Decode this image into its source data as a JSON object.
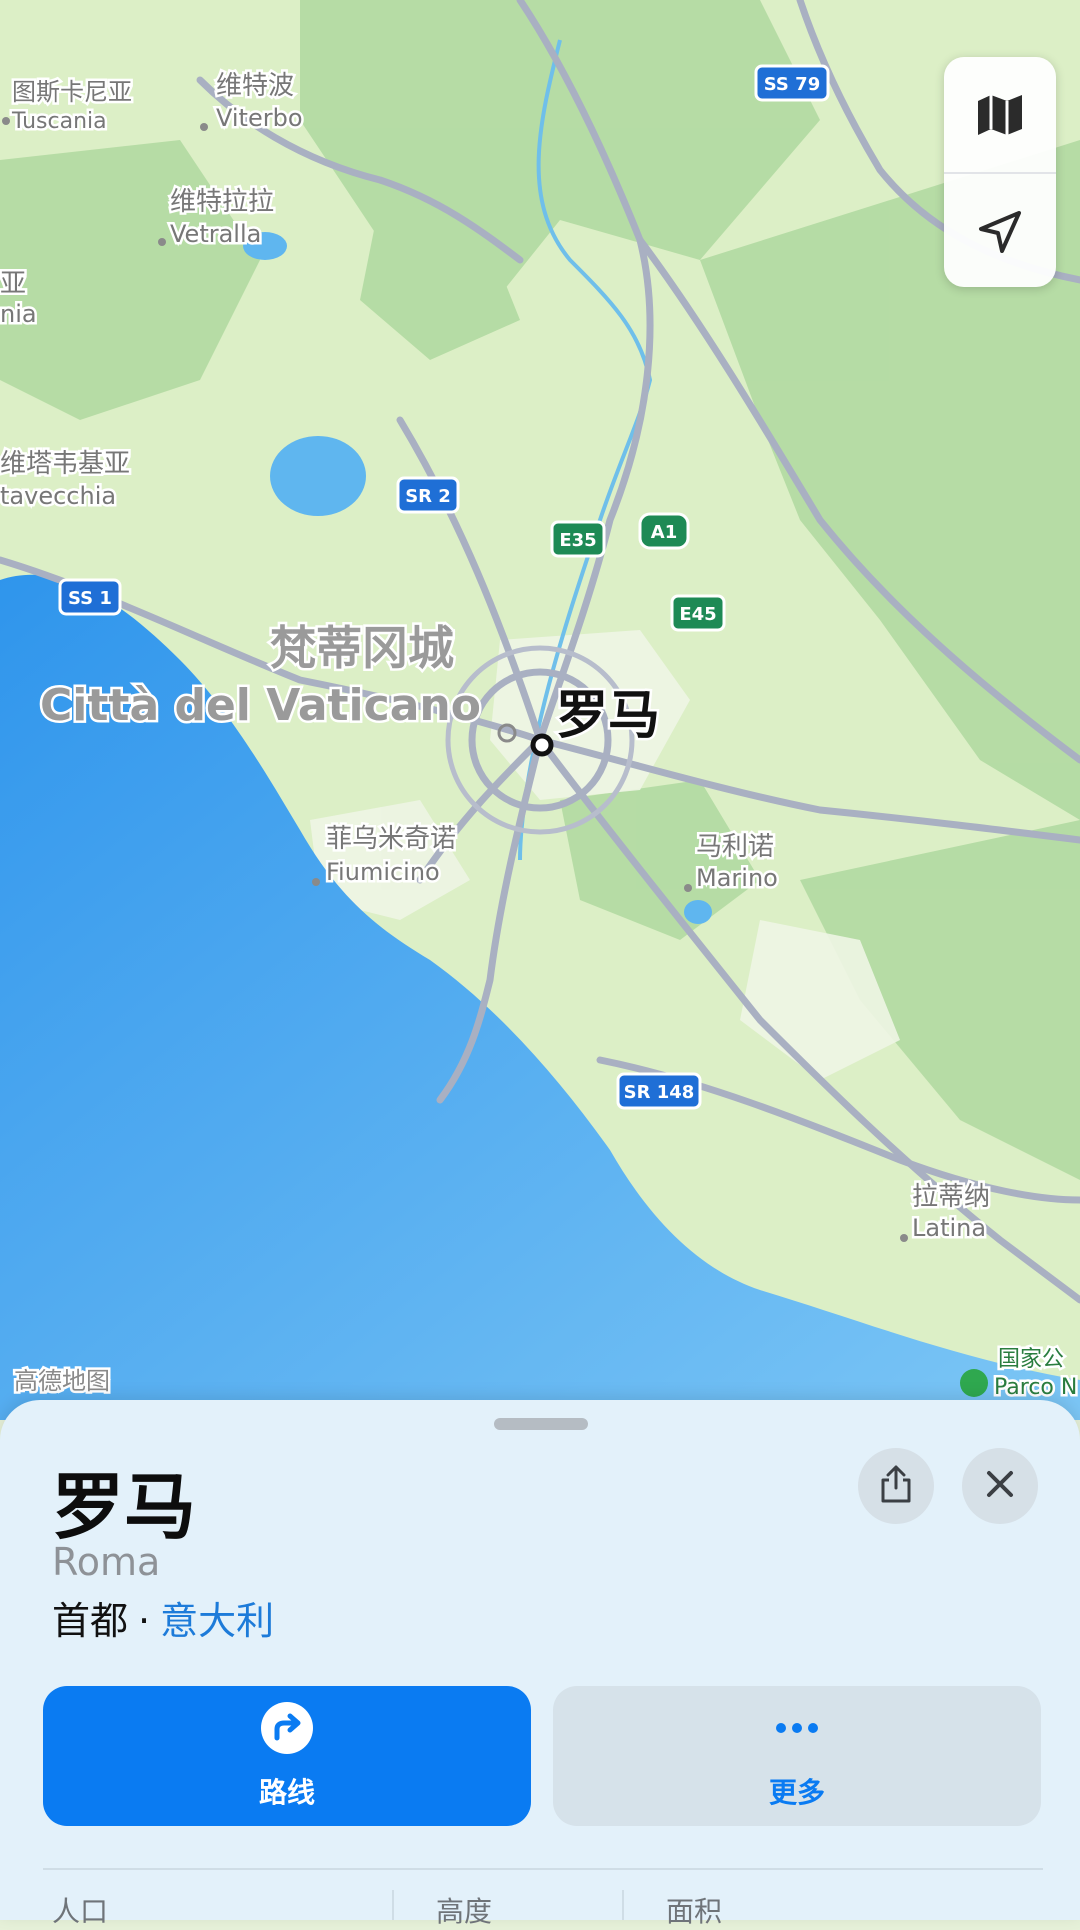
{
  "map": {
    "attribution": "高德地图",
    "places": [
      {
        "cn": "图斯卡尼亚",
        "latin": "Tuscania"
      },
      {
        "cn": "维特波",
        "latin": "Viterbo"
      },
      {
        "cn": "维特拉拉",
        "latin": "Vetralla"
      },
      {
        "cn": "亚",
        "latin": "nia"
      },
      {
        "cn": "维塔韦基亚",
        "latin": "tavecchia"
      },
      {
        "cn": "梵蒂冈城",
        "latin": "Città del Vaticano"
      },
      {
        "cn": "罗马",
        "latin": ""
      },
      {
        "cn": "菲乌米奇诺",
        "latin": "Fiumicino"
      },
      {
        "cn": "马利诺",
        "latin": "Marino"
      },
      {
        "cn": "拉蒂纳",
        "latin": "Latina"
      },
      {
        "cn": "国家公",
        "latin": "Parco N"
      }
    ],
    "road_shields": [
      {
        "label": "SS 79",
        "kind": "blue"
      },
      {
        "label": "SR 2",
        "kind": "blue"
      },
      {
        "label": "E35",
        "kind": "green"
      },
      {
        "label": "A1",
        "kind": "green"
      },
      {
        "label": "E45",
        "kind": "green"
      },
      {
        "label": "SS 1",
        "kind": "blue"
      },
      {
        "label": "SR 148",
        "kind": "blue"
      }
    ],
    "controls": {
      "map_mode_icon": "map-icon",
      "location_icon": "location-arrow-icon"
    }
  },
  "card": {
    "title": "罗马",
    "subtitle": "Roma",
    "category": "首都",
    "separator": "·",
    "country_link": "意大利",
    "share_icon": "share-icon",
    "close_icon": "close-icon",
    "actions": {
      "route_label": "路线",
      "route_icon": "directions-icon",
      "more_label": "更多",
      "more_icon": "ellipsis-icon"
    },
    "stats": [
      {
        "label": "人口"
      },
      {
        "label": "高度"
      },
      {
        "label": "面积"
      }
    ]
  },
  "colors": {
    "sea": "#4aa8ee",
    "land": "#d8ecc0",
    "accent": "#0a7bf2",
    "link": "#1d7bd9"
  }
}
